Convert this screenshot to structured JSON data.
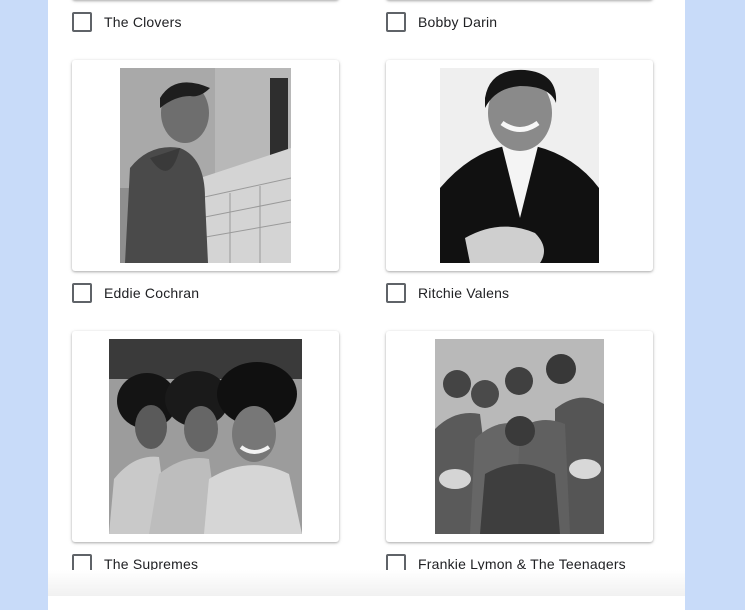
{
  "options": [
    {
      "id": "clovers",
      "label": "The Clovers"
    },
    {
      "id": "bobby-darin",
      "label": "Bobby Darin"
    },
    {
      "id": "eddie-cochran",
      "label": "Eddie Cochran"
    },
    {
      "id": "ritchie-valens",
      "label": "Ritchie Valens"
    },
    {
      "id": "supremes",
      "label": "The Supremes"
    },
    {
      "id": "frankie-lymon",
      "label": "Frankie Lymon & The Teenagers"
    }
  ],
  "colors": {
    "page_background": "#c8dbf9",
    "card": "#ffffff",
    "checkbox_border": "#5f6368",
    "text": "#202124"
  }
}
